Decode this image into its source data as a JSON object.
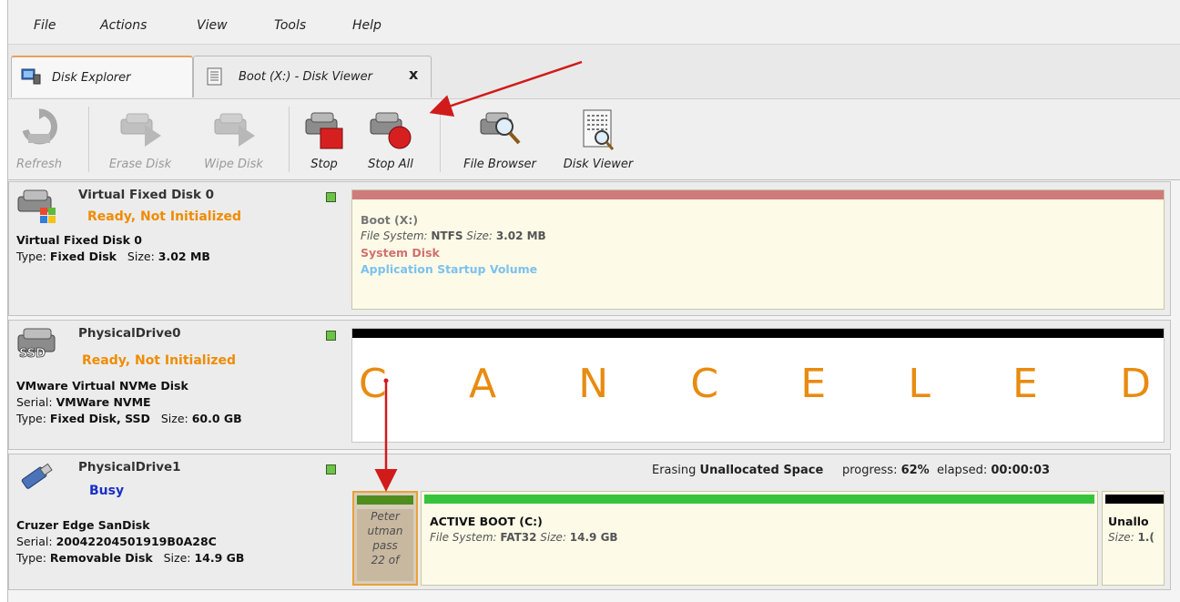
{
  "menu": [
    "File",
    "Actions",
    "View",
    "Tools",
    "Help"
  ],
  "tabs": [
    {
      "label": "Disk Explorer",
      "active": true
    },
    {
      "label": "Boot (X:) - Disk Viewer",
      "close": "x"
    }
  ],
  "toolbar": {
    "refresh": "Refresh",
    "erase_disk": "Erase Disk",
    "wipe_disk": "Wipe Disk",
    "stop": "Stop",
    "stop_all": "Stop All",
    "file_browser": "File Browser",
    "disk_viewer": "Disk Viewer"
  },
  "disks": [
    {
      "title": "Virtual Fixed Disk 0",
      "status": "Ready, Not Initialized",
      "model": "Virtual Fixed Disk 0",
      "type_label": "Type:",
      "type_value": "Fixed Disk",
      "size_label": "Size:",
      "size_value": "3.02 MB",
      "volume": {
        "name": "Boot (X:)",
        "fs_label": "File System:",
        "fs_value": "NTFS",
        "size_label": "Size:",
        "size_value": "3.02 MB",
        "system_disk": "System Disk",
        "app_volume": "Application Startup Volume",
        "bar_color": "#c96b6b"
      }
    },
    {
      "title": "PhysicalDrive0",
      "status": "Ready, Not Initialized",
      "model": "VMware Virtual NVMe Disk",
      "serial_label": "Serial:",
      "serial_value": "VMWare NVME",
      "type_label": "Type:",
      "type_value": "Fixed Disk, SSD",
      "size_label": "Size:",
      "size_value": "60.0 GB",
      "canceled": [
        "C",
        "A",
        "N",
        "C",
        "E",
        "L",
        "E",
        "D"
      ]
    },
    {
      "title": "PhysicalDrive1",
      "status": "Busy",
      "model": "Cruzer Edge SanDisk",
      "serial_label": "Serial:",
      "serial_value": "20042204501919B0A28C",
      "type_label": "Type:",
      "type_value": "Removable Disk",
      "size_label": "Size:",
      "size_value": "14.9 GB",
      "progress": {
        "prefix": "Erasing",
        "target": "Unallocated Space",
        "progress_label": "progress:",
        "progress_value": "62%",
        "elapsed_label": "elapsed:",
        "elapsed_value": "00:00:03"
      },
      "small_volume_text": [
        "Peter",
        "utman",
        "pass",
        "22 of"
      ],
      "volume": {
        "name": "ACTIVE BOOT (C:)",
        "fs_label": "File System:",
        "fs_value": "FAT32",
        "size_label": "Size:",
        "size_value": "14.9 GB"
      },
      "unalloc": {
        "name": "Unallo",
        "size_label": "Size:",
        "size_value": "1.("
      }
    }
  ],
  "colors": {
    "status_ready": "#f08c00",
    "status_busy": "#1a2fc6",
    "canceled_text": "#e88b10",
    "volume_bar_green": "#38c33c",
    "annotation_arrow": "#d11a1a"
  }
}
